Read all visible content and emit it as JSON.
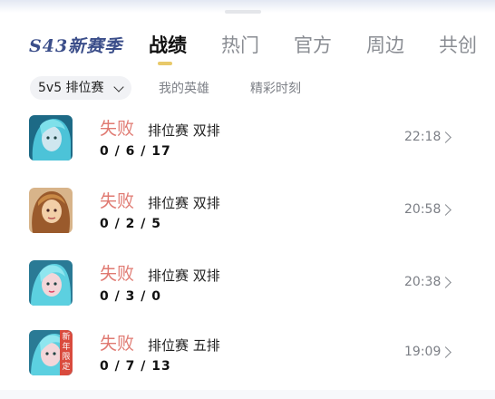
{
  "tabs": {
    "season": "S43新赛季",
    "items": [
      "战绩",
      "热门",
      "官方",
      "周边",
      "共创"
    ],
    "active_index": 0,
    "accent_color": "#e8c96a"
  },
  "filters": {
    "mode_select": "5v5 排位赛",
    "links": [
      "我的英雄",
      "精彩时刻"
    ]
  },
  "matches": [
    {
      "result": "失败",
      "mode": "排位赛 双排",
      "kda": "0 / 6 / 17",
      "time": "22:18",
      "hero_icon": "hero-portrait-teal"
    },
    {
      "result": "失败",
      "mode": "排位赛 双排",
      "kda": "0 / 2 / 5",
      "time": "20:58",
      "hero_icon": "hero-portrait-blonde"
    },
    {
      "result": "失败",
      "mode": "排位赛 双排",
      "kda": "0 / 3 / 0",
      "time": "20:38",
      "hero_icon": "hero-portrait-teal"
    },
    {
      "result": "失败",
      "mode": "排位赛 五排",
      "kda": "0 / 7 / 13",
      "time": "19:09",
      "hero_icon": "hero-portrait-teal",
      "badge": "新年限定"
    }
  ],
  "colors": {
    "loss": "#e07a72",
    "time": "#7c7f86"
  }
}
